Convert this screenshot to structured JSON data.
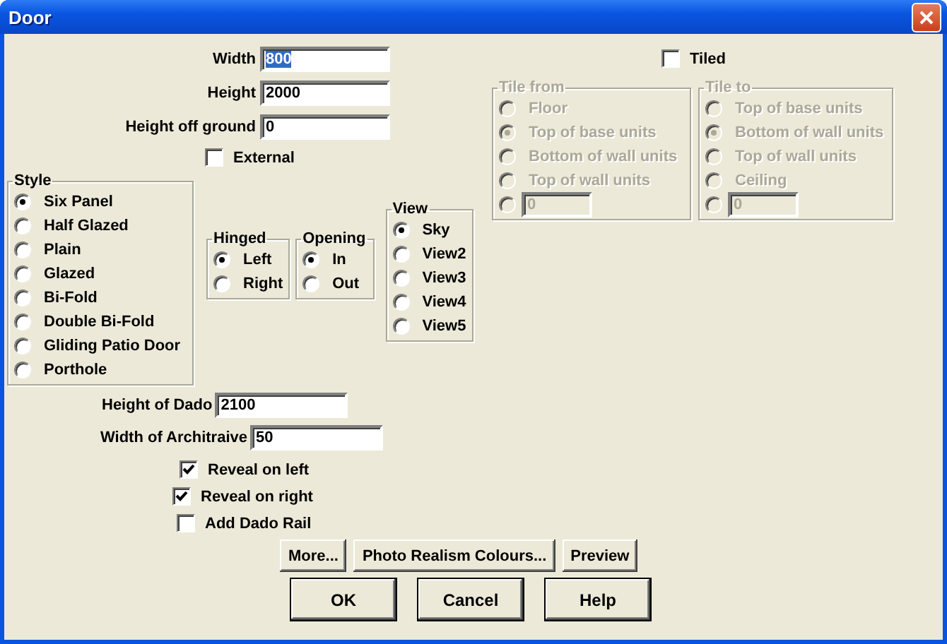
{
  "window": {
    "title": "Door"
  },
  "fields": [
    {
      "label": "Width",
      "value": "800",
      "selected": true
    },
    {
      "label": "Height",
      "value": "2000",
      "selected": false
    },
    {
      "label": "Height off ground",
      "value": "0",
      "selected": false
    }
  ],
  "external": {
    "label": "External",
    "checked": false
  },
  "tiled": {
    "label": "Tiled",
    "checked": false
  },
  "style": {
    "title": "Style",
    "options": [
      {
        "label": "Six Panel",
        "selected": true
      },
      {
        "label": "Half Glazed",
        "selected": false
      },
      {
        "label": "Plain",
        "selected": false
      },
      {
        "label": "Glazed",
        "selected": false
      },
      {
        "label": "Bi-Fold",
        "selected": false
      },
      {
        "label": "Double Bi-Fold",
        "selected": false
      },
      {
        "label": "Gliding Patio Door",
        "selected": false
      },
      {
        "label": "Porthole",
        "selected": false
      }
    ]
  },
  "hinged": {
    "title": "Hinged",
    "options": [
      {
        "label": "Left",
        "selected": true
      },
      {
        "label": "Right",
        "selected": false
      }
    ]
  },
  "opening": {
    "title": "Opening",
    "options": [
      {
        "label": "In",
        "selected": true
      },
      {
        "label": "Out",
        "selected": false
      }
    ]
  },
  "view": {
    "title": "View",
    "options": [
      {
        "label": "Sky",
        "selected": true
      },
      {
        "label": "View2",
        "selected": false
      },
      {
        "label": "View3",
        "selected": false
      },
      {
        "label": "View4",
        "selected": false
      },
      {
        "label": "View5",
        "selected": false
      }
    ]
  },
  "tile_from": {
    "title": "Tile from",
    "disabled": true,
    "options": [
      {
        "kind": "label",
        "label": "Floor",
        "selected": false
      },
      {
        "kind": "label",
        "label": "Top of base units",
        "selected": true
      },
      {
        "kind": "label",
        "label": "Bottom of wall units",
        "selected": false
      },
      {
        "kind": "label",
        "label": "Top of wall units",
        "selected": false
      },
      {
        "kind": "field",
        "value": "0",
        "selected": false
      }
    ]
  },
  "tile_to": {
    "title": "Tile to",
    "disabled": true,
    "options": [
      {
        "kind": "label",
        "label": "Top of base units",
        "selected": false
      },
      {
        "kind": "label",
        "label": "Bottom of wall units",
        "selected": true
      },
      {
        "kind": "label",
        "label": "Top of wall units",
        "selected": false
      },
      {
        "kind": "label",
        "label": "Ceiling",
        "selected": false
      },
      {
        "kind": "field",
        "value": "0",
        "selected": false
      }
    ]
  },
  "dado": {
    "label": "Height of Dado",
    "value": "2100"
  },
  "architrave": {
    "label": "Width of Architraive",
    "value": "50"
  },
  "checkboxes": [
    {
      "label": "Reveal on left",
      "checked": true
    },
    {
      "label": "Reveal on right",
      "checked": true
    },
    {
      "label": "Add Dado Rail",
      "checked": false
    }
  ],
  "action_buttons": [
    "More...",
    "Photo Realism Colours...",
    "Preview"
  ],
  "dialog_buttons": [
    "OK",
    "Cancel",
    "Help"
  ]
}
